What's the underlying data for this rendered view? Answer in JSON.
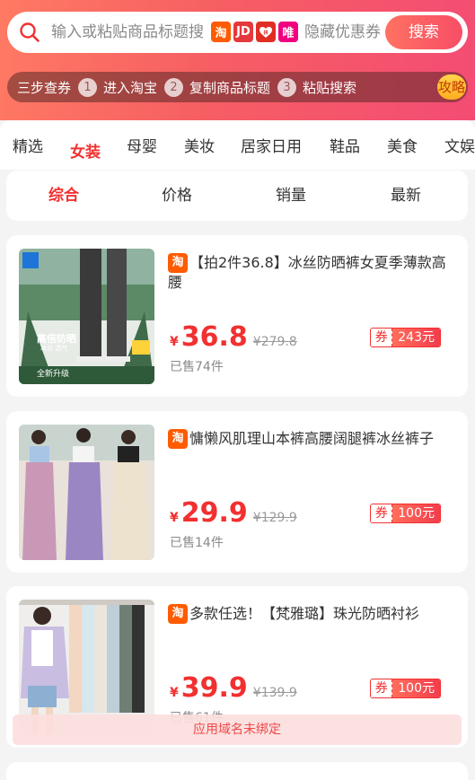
{
  "search": {
    "placeholder": "输入或粘贴商品标题搜",
    "platforms": [
      "淘",
      "JD",
      "拼",
      "唯"
    ],
    "hidden_coupon_text": "隐藏优惠券",
    "button_label": "搜索"
  },
  "steps": {
    "intro": "三步查券",
    "items": [
      {
        "num": "1",
        "label": "进入淘宝"
      },
      {
        "num": "2",
        "label": "复制商品标题"
      },
      {
        "num": "3",
        "label": "粘贴搜索"
      }
    ],
    "guide_label": "攻略"
  },
  "categories": [
    "精选",
    "女装",
    "母婴",
    "美妆",
    "居家日用",
    "鞋品",
    "美食",
    "文娱"
  ],
  "active_category": "女装",
  "sort": [
    "综合",
    "价格",
    "销量",
    "最新"
  ],
  "active_sort": "综合",
  "products": [
    {
      "platform_tag": "淘",
      "title": "【拍2件36.8】冰丝防晒裤女夏季薄款高腰",
      "yen": "¥",
      "price": "36.8",
      "original_price": "¥279.8",
      "coupon_icon": "券",
      "coupon_value": "243元",
      "sold": "已售74件",
      "thumb_text": [
        "高倍防晒",
        "冰丝 透气",
        "全新升级"
      ]
    },
    {
      "platform_tag": "淘",
      "title": "慵懒风肌理山本裤高腰阔腿裤冰丝裤子",
      "yen": "¥",
      "price": "29.9",
      "original_price": "¥129.9",
      "coupon_icon": "券",
      "coupon_value": "100元",
      "sold": "已售14件",
      "thumb_text": []
    },
    {
      "platform_tag": "淘",
      "title": "多款任选！【梵雅璐】珠光防晒衬衫",
      "yen": "¥",
      "price": "39.9",
      "original_price": "¥139.9",
      "coupon_icon": "券",
      "coupon_value": "100元",
      "sold": "已售61件",
      "thumb_text": []
    }
  ],
  "toast": "应用域名未绑定",
  "colors": {
    "accent": "#f23030",
    "header_start": "#ff7a63",
    "header_end": "#f44c74",
    "taobao": "#ff5b00"
  }
}
